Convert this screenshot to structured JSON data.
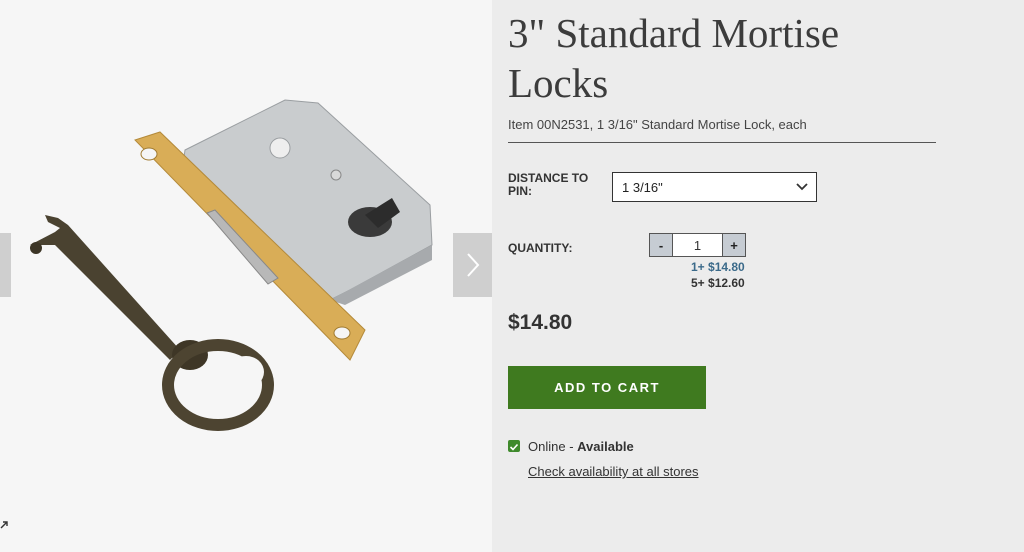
{
  "product": {
    "title": "3\" Standard Mortise Locks",
    "item_line": "Item 00N2531, 1 3/16\" Standard Mortise Lock, each"
  },
  "gallery": {
    "image_icon": "mortise-lock-with-key-image",
    "prev_icon": "chevron-left-icon",
    "next_icon": "chevron-right-icon",
    "expand_icon": "expand-arrow-icon"
  },
  "options": {
    "distance_label": "DISTANCE TO PIN:",
    "distance_value": "1 3/16\""
  },
  "quantity": {
    "label": "QUANTITY:",
    "minus": "-",
    "value": "1",
    "plus": "+",
    "tiers": [
      "1+ $14.80",
      "5+ $12.60"
    ]
  },
  "price": "$14.80",
  "cart": {
    "label": "ADD TO CART"
  },
  "availability": {
    "channel": "Online",
    "separator": " - ",
    "status": "Available",
    "link": "Check availability at all stores"
  },
  "colors": {
    "cart_button": "#3f7a1f",
    "checkbox": "#3f8a2c",
    "tier_highlight": "#3b6a8a"
  }
}
